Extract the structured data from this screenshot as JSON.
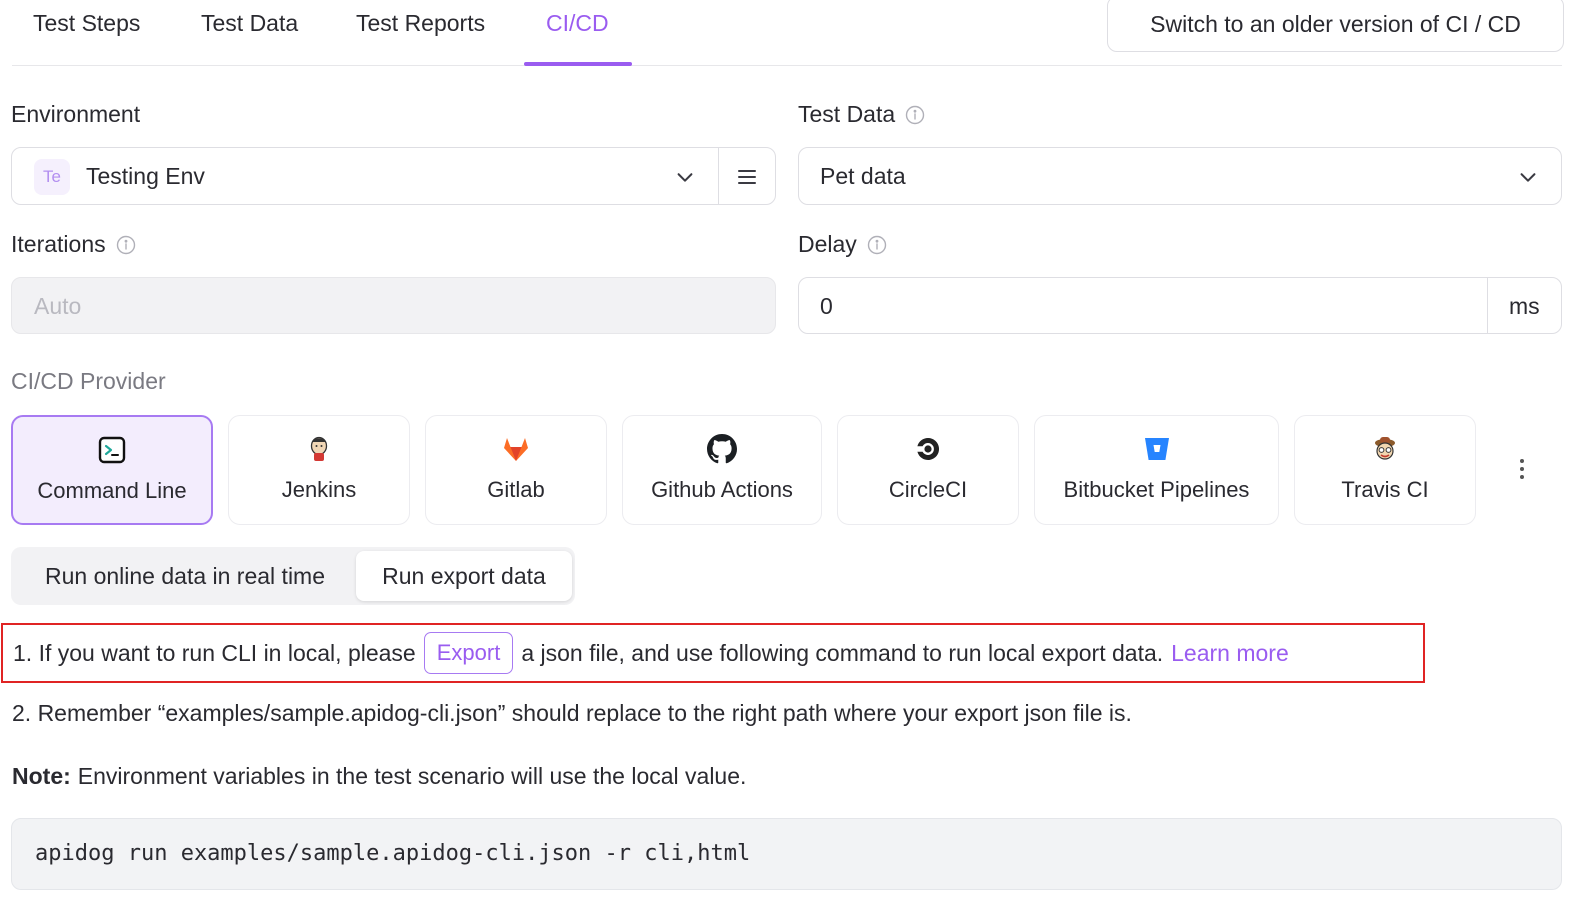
{
  "tabs": [
    {
      "label": "Test Steps",
      "active": false
    },
    {
      "label": "Test Data",
      "active": false
    },
    {
      "label": "Test Reports",
      "active": false
    },
    {
      "label": "CI/CD",
      "active": true
    }
  ],
  "switch_button": "Switch to an older version of CI / CD",
  "environment": {
    "label": "Environment",
    "badge": "Te",
    "value": "Testing Env"
  },
  "test_data": {
    "label": "Test Data",
    "value": "Pet data"
  },
  "iterations": {
    "label": "Iterations",
    "placeholder": "Auto"
  },
  "delay": {
    "label": "Delay",
    "value": "0",
    "unit": "ms"
  },
  "provider": {
    "label": "CI/CD Provider",
    "items": [
      {
        "label": "Command Line",
        "icon": "terminal-icon",
        "selected": true
      },
      {
        "label": "Jenkins",
        "icon": "jenkins-icon",
        "selected": false
      },
      {
        "label": "Gitlab",
        "icon": "gitlab-icon",
        "selected": false
      },
      {
        "label": "Github Actions",
        "icon": "github-icon",
        "selected": false
      },
      {
        "label": "CircleCI",
        "icon": "circleci-icon",
        "selected": false
      },
      {
        "label": "Bitbucket Pipelines",
        "icon": "bitbucket-icon",
        "selected": false
      },
      {
        "label": "Travis CI",
        "icon": "travis-icon",
        "selected": false
      }
    ]
  },
  "run_mode": {
    "options": [
      "Run online data in real time",
      "Run export data"
    ],
    "selected": "Run export data"
  },
  "instructions": {
    "line1_prefix": "1. If you want to run CLI in local, please",
    "export_button": "Export",
    "line1_suffix": "a json file, and use following command to run local export data.",
    "learn_more": "Learn more",
    "line2": "2. Remember “examples/sample.apidog-cli.json” should replace to the right path where your export json file is.",
    "note_label": "Note:",
    "note_text": "Environment variables in the test scenario will use the local value."
  },
  "command": "apidog run examples/sample.apidog-cli.json -r cli,html",
  "colors": {
    "accent": "#9a5cf0",
    "highlight_border": "#e02424"
  }
}
